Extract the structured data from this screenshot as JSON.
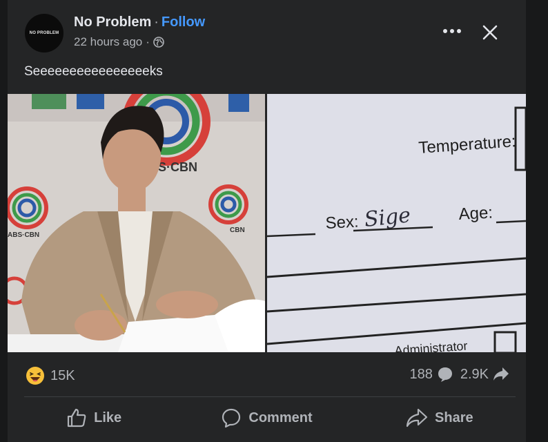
{
  "post": {
    "author": "No Problem",
    "separator": "·",
    "follow_label": "Follow",
    "time": "22 hours ago",
    "meta_sep": "·",
    "avatar_text": "NO PROBLEM",
    "caption": "Seeeeeeeeeeeeeeeeks",
    "icons": {
      "audience": "globe-icon",
      "more": "more-options-icon",
      "close": "close-icon"
    }
  },
  "images": {
    "left": {
      "logo_text_1": "S·CBN",
      "logo_text_2": "ABS·CBN",
      "logo_text_3": "CBN"
    },
    "right": {
      "temperature_label": "Temperature:",
      "sex_label": "Sex:",
      "sex_value": "Sige",
      "age_label": "Age:",
      "bottom_label": "Administrator"
    }
  },
  "stats": {
    "reaction_icon": "haha-emoji-icon",
    "reaction_count": "15K",
    "comments_count": "188",
    "shares_count": "2.9K"
  },
  "actions": {
    "like_label": "Like",
    "comment_label": "Comment",
    "share_label": "Share"
  },
  "colors": {
    "card_bg": "#242526",
    "page_bg": "#18191a",
    "link_blue": "#4599ff",
    "text_primary": "#e4e6eb",
    "text_secondary": "#b0b3b8"
  }
}
